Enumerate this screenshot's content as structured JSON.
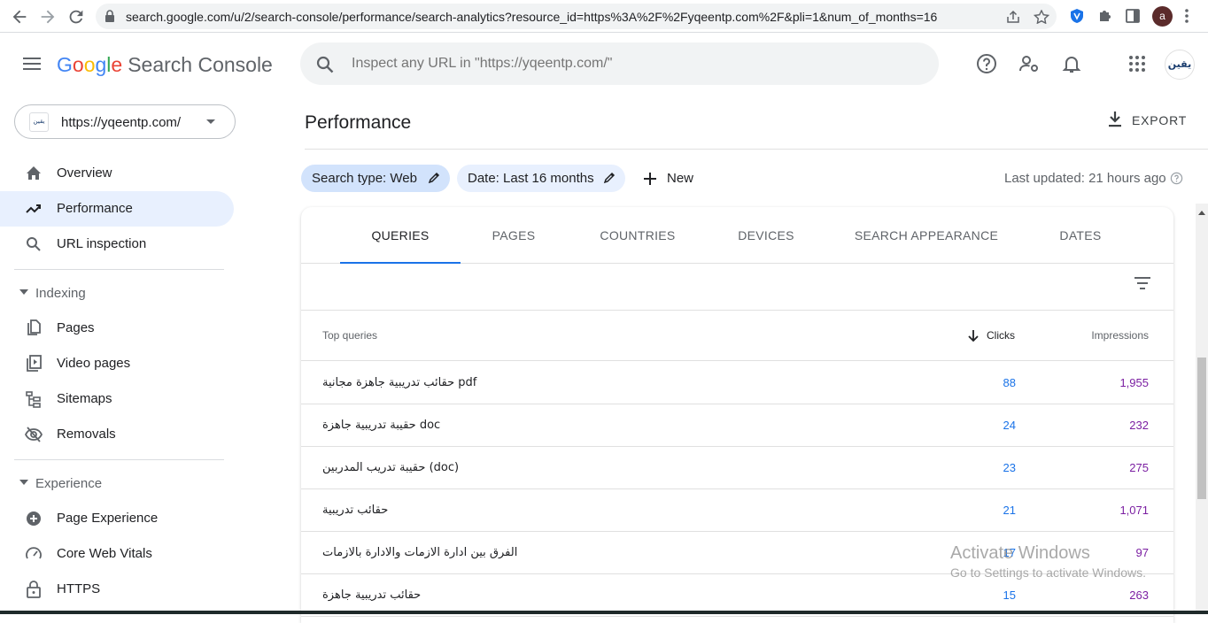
{
  "browser": {
    "url": "search.google.com/u/2/search-console/performance/search-analytics?resource_id=https%3A%2F%2Fyqeentp.com%2F&pli=1&num_of_months=16",
    "profile_initial": "a"
  },
  "header": {
    "logo_letters": [
      "G",
      "o",
      "o",
      "g",
      "l",
      "e"
    ],
    "product": "Search Console",
    "search_placeholder": "Inspect any URL in \"https://yqeentp.com/\"",
    "avatar_text": "يقين"
  },
  "sidebar": {
    "property_favicon": "يقين",
    "property_url": "https://yqeentp.com/",
    "items": [
      {
        "label": "Overview",
        "icon": "home-icon"
      },
      {
        "label": "Performance",
        "icon": "trending-up-icon"
      },
      {
        "label": "URL inspection",
        "icon": "search-icon"
      }
    ],
    "indexing": {
      "title": "Indexing",
      "items": [
        {
          "label": "Pages",
          "icon": "pages-icon"
        },
        {
          "label": "Video pages",
          "icon": "video-pages-icon"
        },
        {
          "label": "Sitemaps",
          "icon": "sitemap-icon"
        },
        {
          "label": "Removals",
          "icon": "visibility-off-icon"
        }
      ]
    },
    "experience": {
      "title": "Experience",
      "items": [
        {
          "label": "Page Experience",
          "icon": "plus-circle-icon"
        },
        {
          "label": "Core Web Vitals",
          "icon": "speed-gauge-icon"
        },
        {
          "label": "HTTPS",
          "icon": "lock-icon"
        }
      ]
    }
  },
  "main": {
    "title": "Performance",
    "export_label": "EXPORT",
    "chips": {
      "search_type": "Search type: Web",
      "date": "Date: Last 16 months",
      "new": "New"
    },
    "last_updated": "Last updated: 21 hours ago",
    "tabs": [
      "QUERIES",
      "PAGES",
      "COUNTRIES",
      "DEVICES",
      "SEARCH APPEARANCE",
      "DATES"
    ],
    "active_tab": "QUERIES",
    "table": {
      "col_query": "Top queries",
      "col_clicks": "Clicks",
      "col_impressions": "Impressions",
      "rows": [
        {
          "query": "حقائب تدريبية جاهزة مجانية pdf",
          "clicks": "88",
          "impressions": "1,955"
        },
        {
          "query": "حقيبة تدريبية جاهزة doc",
          "clicks": "24",
          "impressions": "232"
        },
        {
          "query": "حقيبة تدريب المدربين (doc)",
          "clicks": "23",
          "impressions": "275"
        },
        {
          "query": "حقائب تدريبية",
          "clicks": "21",
          "impressions": "1,071"
        },
        {
          "query": "الفرق بين ادارة الازمات والادارة بالازمات",
          "clicks": "17",
          "impressions": "97"
        },
        {
          "query": "حقائب تدريبية جاهزة",
          "clicks": "15",
          "impressions": "263"
        }
      ]
    }
  },
  "watermark": {
    "line1": "Activate Windows",
    "line2": "Go to Settings to activate Windows."
  },
  "colors": {
    "clicks": "#1a73e8",
    "impressions": "#7b1fa2",
    "active_nav": "#e8f0fe"
  }
}
